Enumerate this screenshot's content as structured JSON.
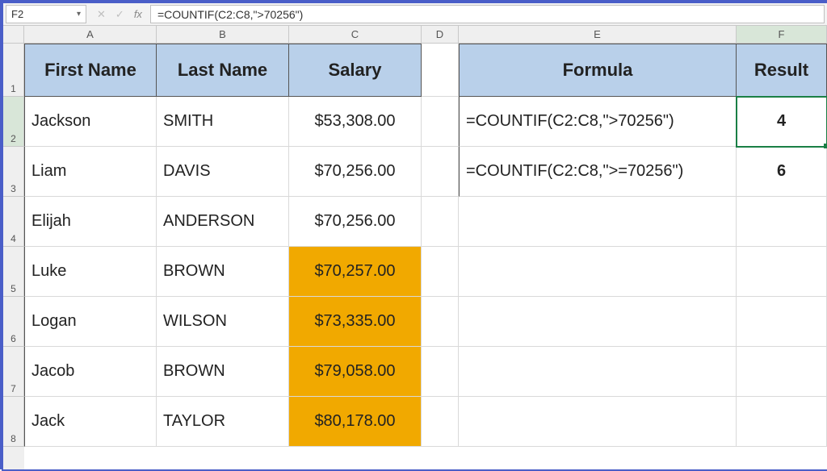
{
  "name_box": "F2",
  "formula_bar": "=COUNTIF(C2:C8,\">70256\")",
  "columns": {
    "A": "A",
    "B": "B",
    "C": "C",
    "D": "D",
    "E": "E",
    "F": "F"
  },
  "row_labels": [
    "1",
    "2",
    "3",
    "4",
    "5",
    "6",
    "7",
    "8"
  ],
  "headers": {
    "first_name": "First Name",
    "last_name": "Last Name",
    "salary": "Salary",
    "formula": "Formula",
    "result": "Result"
  },
  "people": [
    {
      "first": "Jackson",
      "last": "SMITH",
      "salary": "$53,308.00",
      "hl": false
    },
    {
      "first": "Liam",
      "last": "DAVIS",
      "salary": "$70,256.00",
      "hl": false
    },
    {
      "first": "Elijah",
      "last": "ANDERSON",
      "salary": "$70,256.00",
      "hl": false
    },
    {
      "first": "Luke",
      "last": "BROWN",
      "salary": "$70,257.00",
      "hl": true
    },
    {
      "first": "Logan",
      "last": "WILSON",
      "salary": "$73,335.00",
      "hl": true
    },
    {
      "first": "Jacob",
      "last": "BROWN",
      "salary": "$79,058.00",
      "hl": true
    },
    {
      "first": "Jack",
      "last": "TAYLOR",
      "salary": "$80,178.00",
      "hl": true
    }
  ],
  "formulas": [
    {
      "text": "=COUNTIF(C2:C8,\">70256\")",
      "result": "4"
    },
    {
      "text": "=COUNTIF(C2:C8,\">=70256\")",
      "result": "6"
    }
  ],
  "icons": {
    "dropdown": "▾",
    "cancel": "✕",
    "enter": "✓",
    "fx": "fx"
  }
}
